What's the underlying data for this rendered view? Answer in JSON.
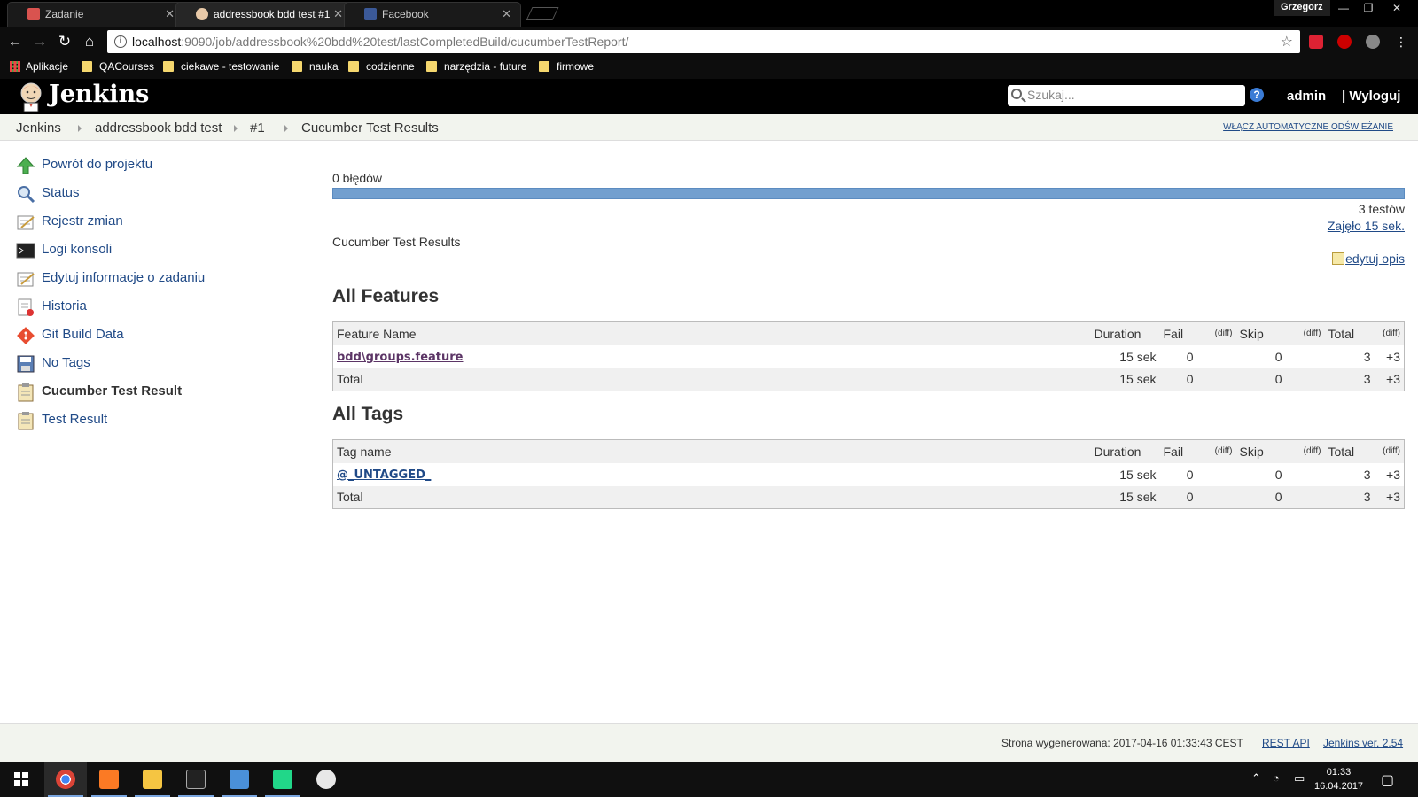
{
  "browser": {
    "tabs": [
      {
        "title": "Zadanie"
      },
      {
        "title": "addressbook bdd test #1"
      },
      {
        "title": "Facebook"
      }
    ],
    "profile": "Grzegorz",
    "url_host": "localhost",
    "url_path": ":9090/job/addressbook%20bdd%20test/lastCompletedBuild/cucumberTestReport/",
    "bookmarks": [
      "Aplikacje",
      "QACourses",
      "ciekawe - testowanie",
      "nauka",
      "codzienne",
      "narzędzia - future",
      "firmowe"
    ]
  },
  "header": {
    "logo": "Jenkins",
    "search_placeholder": "Szukaj...",
    "user": "admin",
    "logout": "| Wyloguj"
  },
  "breadcrumbs": {
    "items": [
      "Jenkins",
      "addressbook bdd test",
      "#1",
      "Cucumber Test Results"
    ],
    "auto_refresh": "WŁĄCZ AUTOMATYCZNE ODŚWIEŻANIE"
  },
  "sidebar": {
    "items": [
      {
        "label": "Powrót do projektu",
        "icon": "up-arrow-icon"
      },
      {
        "label": "Status",
        "icon": "magnifier-icon"
      },
      {
        "label": "Rejestr zmian",
        "icon": "notepad-icon"
      },
      {
        "label": "Logi konsoli",
        "icon": "terminal-icon"
      },
      {
        "label": "Edytuj informacje o zadaniu",
        "icon": "notepad-icon"
      },
      {
        "label": "Historia",
        "icon": "notepad-icon"
      },
      {
        "label": "Git Build Data",
        "icon": "git-icon"
      },
      {
        "label": "No Tags",
        "icon": "save-icon"
      },
      {
        "label": "Cucumber Test Result",
        "icon": "clipboard-icon"
      },
      {
        "label": "Test Result",
        "icon": "clipboard-icon"
      }
    ]
  },
  "summary": {
    "failures": "0 błędów",
    "failure_fraction": 0,
    "total_tests": "3 testów",
    "duration": "Zajęło 15 sek.",
    "description": "Cucumber Test Results",
    "edit_description": "edytuj opis"
  },
  "features": {
    "heading": "All Features",
    "columns": [
      "Feature Name",
      "Duration",
      "Fail",
      "(diff)",
      "Skip",
      "(diff)",
      "Total",
      "(diff)"
    ],
    "rows": [
      {
        "name": "bdd\\groups.feature",
        "duration": "15 sek",
        "fail": "0",
        "fail_diff": "",
        "skip": "0",
        "skip_diff": "",
        "total": "3",
        "total_diff": "+3"
      }
    ],
    "total": {
      "name": "Total",
      "duration": "15 sek",
      "fail": "0",
      "fail_diff": "",
      "skip": "0",
      "skip_diff": "",
      "total": "3",
      "total_diff": "+3"
    }
  },
  "tags": {
    "heading": "All Tags",
    "columns": [
      "Tag name",
      "Duration",
      "Fail",
      "(diff)",
      "Skip",
      "(diff)",
      "Total",
      "(diff)"
    ],
    "rows": [
      {
        "name": "@_UNTAGGED_",
        "duration": "15 sek",
        "fail": "0",
        "fail_diff": "",
        "skip": "0",
        "skip_diff": "",
        "total": "3",
        "total_diff": "+3"
      }
    ],
    "total": {
      "name": "Total",
      "duration": "15 sek",
      "fail": "0",
      "fail_diff": "",
      "skip": "0",
      "skip_diff": "",
      "total": "3",
      "total_diff": "+3"
    }
  },
  "footer": {
    "generated": "Strona wygenerowana: 2017-04-16 01:33:43 CEST",
    "rest_api": "REST API",
    "version": "Jenkins ver. 2.54"
  },
  "taskbar": {
    "time": "01:33",
    "date": "16.04.2017"
  },
  "colors": {
    "progress_pass": "#729fcf",
    "link": "#204a87",
    "visited_link": "#5c3566"
  }
}
